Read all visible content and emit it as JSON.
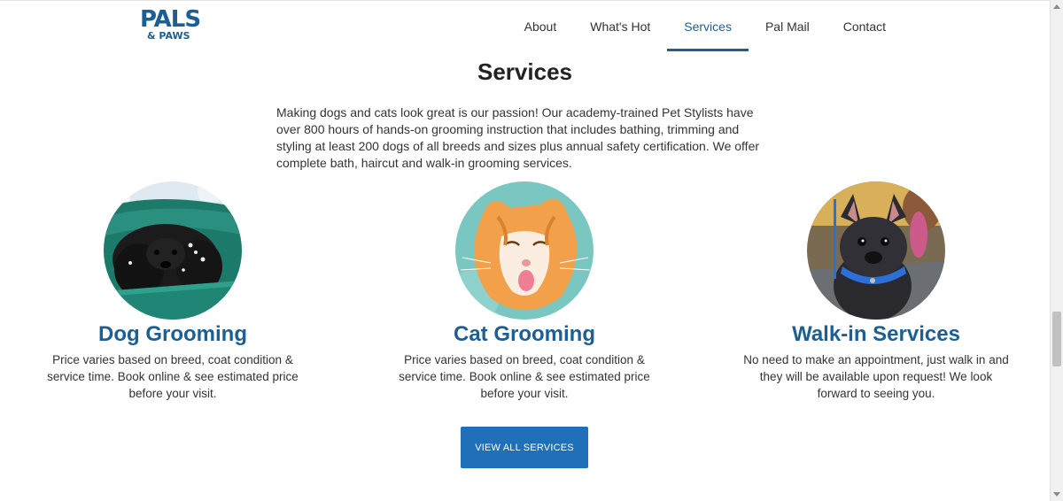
{
  "brand": {
    "logo_line1": "PALS",
    "logo_line2": "& PAWS",
    "brand_color": "#1d5f92"
  },
  "nav": {
    "items": [
      {
        "label": "About",
        "active": false
      },
      {
        "label": "What's Hot",
        "active": false
      },
      {
        "label": "Services",
        "active": true
      },
      {
        "label": "Pal Mail",
        "active": false
      },
      {
        "label": "Contact",
        "active": false
      }
    ]
  },
  "main": {
    "title": "Services",
    "intro": "Making dogs and cats look great is our passion! Our academy-trained Pet Stylists have over 800 hours of hands-on grooming instruction that includes bathing, trimming and styling at least 200 dogs of all breeds and sizes plus annual safety certification. We offer complete bath, haircut and walk-in grooming services.",
    "services": [
      {
        "title": "Dog Grooming",
        "description": "Price varies based on breed, coat condition & service time. Book online & see estimated price before your visit.",
        "image": "dog-in-bath-photo"
      },
      {
        "title": "Cat Grooming",
        "description": "Price varies based on breed, coat condition & service time. Book online & see estimated price before your visit.",
        "image": "orange-cat-photo"
      },
      {
        "title": "Walk-in Services",
        "description": "No need to make an appointment, just walk in and they will be available upon request! We look forward to seeing you.",
        "image": "french-bulldog-photo"
      }
    ],
    "cta_label": "VIEW ALL SERVICES",
    "cta_color": "#1f70b8"
  }
}
